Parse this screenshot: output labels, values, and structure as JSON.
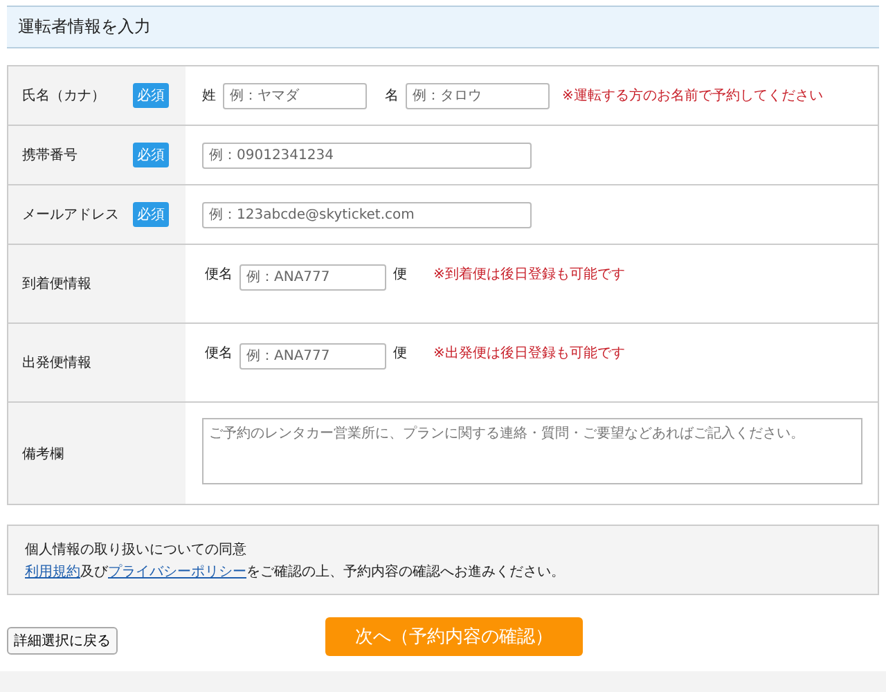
{
  "section_title": "運転者情報を入力",
  "rows": [
    {
      "kind": "name",
      "label": "氏名（カナ）",
      "required_badge": "必須",
      "fields": [
        {
          "prefix": "姓",
          "placeholder": "例：ヤマダ"
        },
        {
          "prefix": "名",
          "placeholder": "例：タロウ"
        }
      ],
      "note": "※運転する方のお名前で予約してください"
    },
    {
      "kind": "single",
      "label": "携帯番号",
      "required_badge": "必須",
      "placeholder": "例：09012341234"
    },
    {
      "kind": "single",
      "label": "メールアドレス",
      "required_badge": "必須",
      "placeholder": "例：123abcde@skyticket.com"
    },
    {
      "kind": "flight",
      "label": "到着便情報",
      "prefix": "便名",
      "placeholder": "例：ANA777",
      "suffix": "便",
      "note": "※到着便は後日登録も可能です"
    },
    {
      "kind": "flight",
      "label": "出発便情報",
      "prefix": "便名",
      "placeholder": "例：ANA777",
      "suffix": "便",
      "note": "※出発便は後日登録も可能です"
    },
    {
      "kind": "textarea",
      "label": "備考欄",
      "placeholder": "ご予約のレンタカー営業所に、プランに関する連絡・質問・ご要望などあればご記入ください。"
    }
  ],
  "consent": {
    "title": "個人情報の取り扱いについての同意",
    "parts": [
      {
        "text": "利用規約",
        "link": true
      },
      {
        "text": "及び",
        "link": false
      },
      {
        "text": "プライバシーポリシー",
        "link": true
      },
      {
        "text": "をご確認の上、予約内容の確認へお進みください。",
        "link": false
      }
    ]
  },
  "back_button": "詳細選択に戻る",
  "next_button": "次へ（予約内容の確認）"
}
